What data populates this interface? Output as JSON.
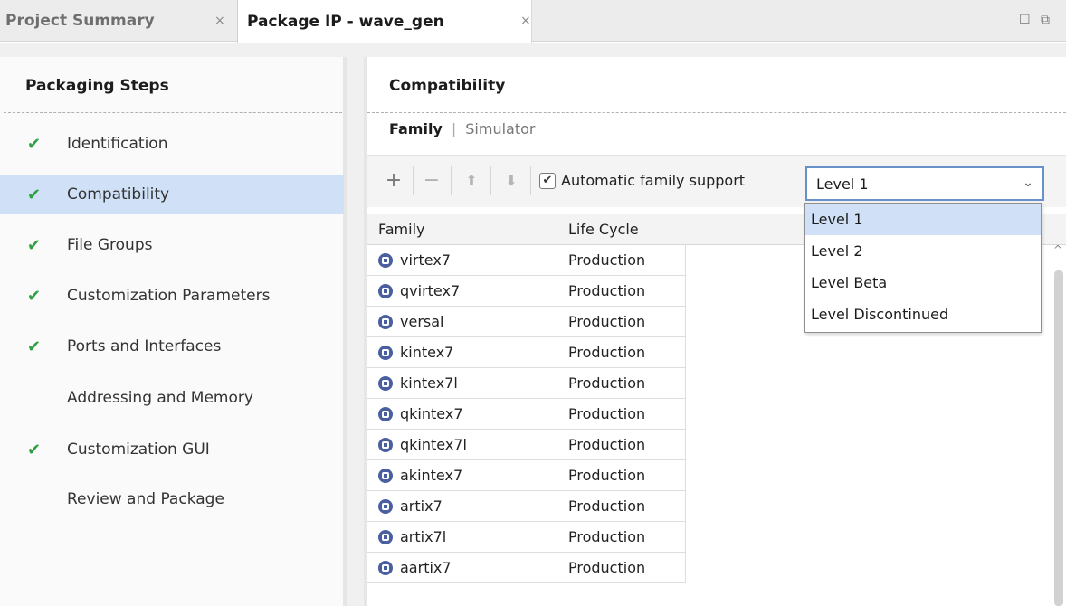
{
  "tabs": [
    {
      "label": "Project Summary",
      "close": "×"
    },
    {
      "label": "Package IP - wave_gen",
      "close": "×"
    }
  ],
  "window_controls": {
    "maximize": "☐",
    "restore": "⧉"
  },
  "left_panel": {
    "title": "Packaging Steps",
    "steps": [
      {
        "label": "Identification",
        "check": "✔"
      },
      {
        "label": "Compatibility",
        "check": "✔"
      },
      {
        "label": "File Groups",
        "check": "✔"
      },
      {
        "label": "Customization Parameters",
        "check": "✔"
      },
      {
        "label": "Ports and Interfaces",
        "check": "✔"
      },
      {
        "label": "Addressing and Memory",
        "check": ""
      },
      {
        "label": "Customization GUI",
        "check": "✔"
      },
      {
        "label": "Review and Package",
        "check": ""
      }
    ],
    "selected_index": 1
  },
  "right_panel": {
    "title": "Compatibility",
    "subtabs": {
      "active": "Family",
      "separator": "|",
      "inactive": "Simulator"
    },
    "toolbar": {
      "add": "+",
      "remove": "−",
      "up": "⬆",
      "down": "⬇",
      "auto_support_label": "Automatic family support",
      "auto_support_checked": "✔",
      "level_selected": "Level 1",
      "chevron": "⌄"
    },
    "dropdown_options": [
      "Level 1",
      "Level 2",
      "Level Beta",
      "Level Discontinued"
    ],
    "table": {
      "headers": [
        "Family",
        "Life Cycle"
      ],
      "rows": [
        {
          "family": "virtex7",
          "life": "Production"
        },
        {
          "family": "qvirtex7",
          "life": "Production"
        },
        {
          "family": "versal",
          "life": "Production"
        },
        {
          "family": "kintex7",
          "life": "Production"
        },
        {
          "family": "kintex7l",
          "life": "Production"
        },
        {
          "family": "qkintex7",
          "life": "Production"
        },
        {
          "family": "qkintex7l",
          "life": "Production"
        },
        {
          "family": "akintex7",
          "life": "Production"
        },
        {
          "family": "artix7",
          "life": "Production"
        },
        {
          "family": "artix7l",
          "life": "Production"
        },
        {
          "family": "aartix7",
          "life": "Production"
        }
      ]
    },
    "scroll_up": "^"
  },
  "colors": {
    "check_green": "#2ea043",
    "selection": "#cfe0f7",
    "select_border": "#6a90c8"
  }
}
